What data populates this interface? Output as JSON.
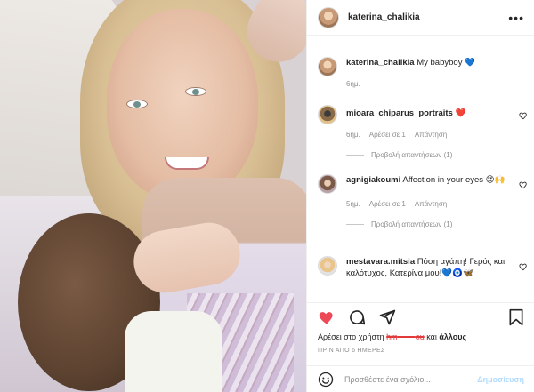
{
  "header": {
    "username": "katerina_chalikia",
    "more_icon": "more-horizontal-icon"
  },
  "caption": {
    "username": "katerina_chalikia",
    "text": "My babyboy 💙",
    "time": "6ημ."
  },
  "comments": [
    {
      "username": "mioara_chiparus_portraits",
      "text": "❤️",
      "time": "6ημ.",
      "likes": "Αρέσει σε 1",
      "reply": "Απάντηση",
      "view_replies": "Προβολή απαντήσεων (1)"
    },
    {
      "username": "agnigiakoumi",
      "text": "Affection in your eyes 😍🙌",
      "time": "5ημ.",
      "likes": "Αρέσει σε 1",
      "reply": "Απάντηση",
      "view_replies": "Προβολή απαντήσεων (1)"
    },
    {
      "username": "mestavara.mitsia",
      "text": "Πόση αγάπη! Γερός και καλότυχος, Κατερίνα μου!💙🧿🦋"
    }
  ],
  "likes_line": {
    "prefix": "Αρέσει στο χρήστη",
    "redacted_name": "hm",
    "redacted_tail": "ou",
    "and": "και",
    "others": "άλλους"
  },
  "timestamp": "ΠΡΙΝ ΑΠΟ 6 ΗΜΕΡΕΣ",
  "add_comment": {
    "placeholder": "Προσθέστε ένα σχόλιο...",
    "post_label": "Δημοσίευση"
  },
  "colors": {
    "like_red": "#ed4956",
    "link_blue_disabled": "#b3dbff",
    "muted_text": "#8e8e8e",
    "border": "#efefef"
  }
}
